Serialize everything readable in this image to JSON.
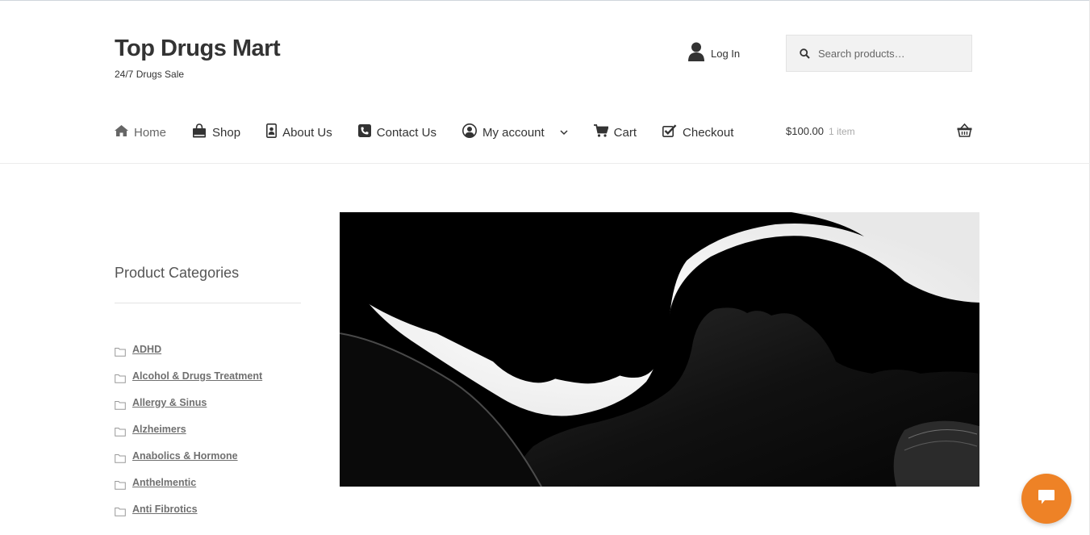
{
  "site": {
    "title": "Top Drugs Mart",
    "tagline": "24/7 Drugs Sale"
  },
  "header": {
    "login_label": "Log In",
    "search_placeholder": "Search products…"
  },
  "nav": {
    "items": [
      {
        "label": "Home",
        "icon": "home-icon"
      },
      {
        "label": "Shop",
        "icon": "shopping-bag-icon"
      },
      {
        "label": "About Us",
        "icon": "contact-card-icon"
      },
      {
        "label": "Contact Us",
        "icon": "phone-icon"
      },
      {
        "label": "My account",
        "icon": "user-circle-icon"
      },
      {
        "label": "Cart",
        "icon": "cart-icon"
      },
      {
        "label": "Checkout",
        "icon": "checkbox-icon"
      }
    ]
  },
  "cart": {
    "total": "$100.00",
    "count": "1 item"
  },
  "sidebar": {
    "title": "Product Categories",
    "categories": [
      "ADHD",
      "Alcohol & Drugs Treatment",
      "Allergy & Sinus",
      "Alzheimers",
      "Anabolics & Hormone",
      "Anthelmentic",
      "Anti Fibrotics"
    ]
  },
  "colors": {
    "chat_button": "#ee8226",
    "text": "#333333",
    "link": "#707070"
  }
}
